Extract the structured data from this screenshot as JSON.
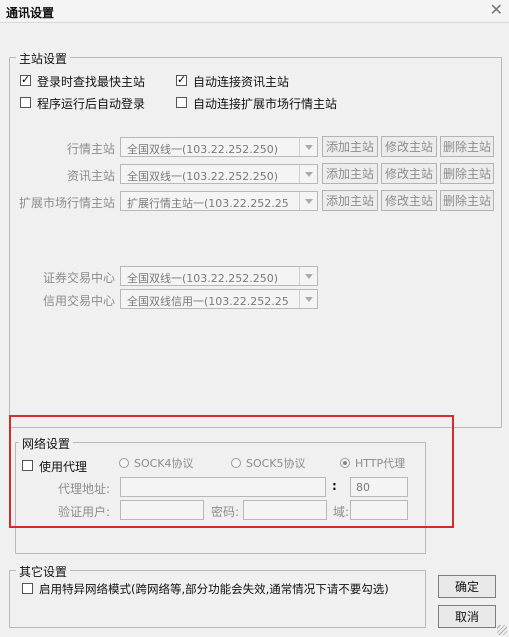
{
  "window": {
    "title": "通讯设置",
    "close_icon": "✕"
  },
  "main_station": {
    "legend": "主站设置",
    "checkboxes": [
      {
        "label": "登录时查找最快主站",
        "checked": true
      },
      {
        "label": "自动连接资讯主站",
        "checked": true
      },
      {
        "label": "程序运行后自动登录",
        "checked": false
      },
      {
        "label": "自动连接扩展市场行情主站",
        "checked": false
      }
    ],
    "rows": [
      {
        "label": "行情主站",
        "value": "全国双线一(103.22.252.250)"
      },
      {
        "label": "资讯主站",
        "value": "全国双线一(103.22.252.250)"
      },
      {
        "label": "扩展市场行情主站",
        "value": "扩展行情主站一(103.22.252.25"
      }
    ],
    "buttons": {
      "add": "添加主站",
      "edit": "修改主站",
      "delete": "删除主站"
    },
    "trade_rows": [
      {
        "label": "证券交易中心",
        "value": "全国双线一(103.22.252.250)"
      },
      {
        "label": "信用交易中心",
        "value": "全国双线信用一(103.22.252.25"
      }
    ]
  },
  "network": {
    "legend": "网络设置",
    "use_proxy": {
      "label": "使用代理",
      "checked": false
    },
    "protocols": [
      {
        "label": "SOCK4协议",
        "selected": false
      },
      {
        "label": "SOCK5协议",
        "selected": false
      },
      {
        "label": "HTTP代理",
        "selected": true
      }
    ],
    "proxy_address_label": "代理地址:",
    "proxy_address_value": "",
    "port_separator": ":",
    "port_value": "80",
    "auth_user_label": "验证用户:",
    "auth_user_value": "",
    "password_label": "密码:",
    "password_value": "",
    "domain_label": "域:",
    "domain_value": ""
  },
  "other": {
    "legend": "其它设置",
    "special_network": {
      "label": "启用特异网络模式(跨网络等,部分功能会失效,通常情况下请不要勾选)",
      "checked": false
    }
  },
  "actions": {
    "ok": "确定",
    "cancel": "取消"
  },
  "colors": {
    "highlight_border": "#d62b2b"
  }
}
